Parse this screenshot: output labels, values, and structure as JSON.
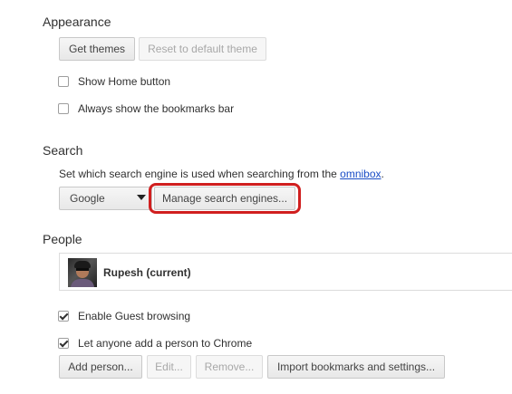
{
  "appearance": {
    "title": "Appearance",
    "get_themes": "Get themes",
    "reset_theme": "Reset to default theme",
    "show_home": {
      "label": "Show Home button",
      "checked": false
    },
    "show_bookmarks": {
      "label": "Always show the bookmarks bar",
      "checked": false
    }
  },
  "search": {
    "title": "Search",
    "description": "Set which search engine is used when searching from the ",
    "omnibox_link": "omnibox",
    "description_end": ".",
    "engine_selected": "Google",
    "manage": "Manage search engines..."
  },
  "people": {
    "title": "People",
    "profile_name": "Rupesh (current)",
    "guest": {
      "label": "Enable Guest browsing",
      "checked": true
    },
    "add_anyone": {
      "label": "Let anyone add a person to Chrome",
      "checked": true
    },
    "buttons": {
      "add": "Add person...",
      "edit": "Edit...",
      "remove": "Remove...",
      "import": "Import bookmarks and settings..."
    }
  },
  "colors": {
    "link": "#1a4dc6",
    "highlight": "#d01f1f"
  }
}
